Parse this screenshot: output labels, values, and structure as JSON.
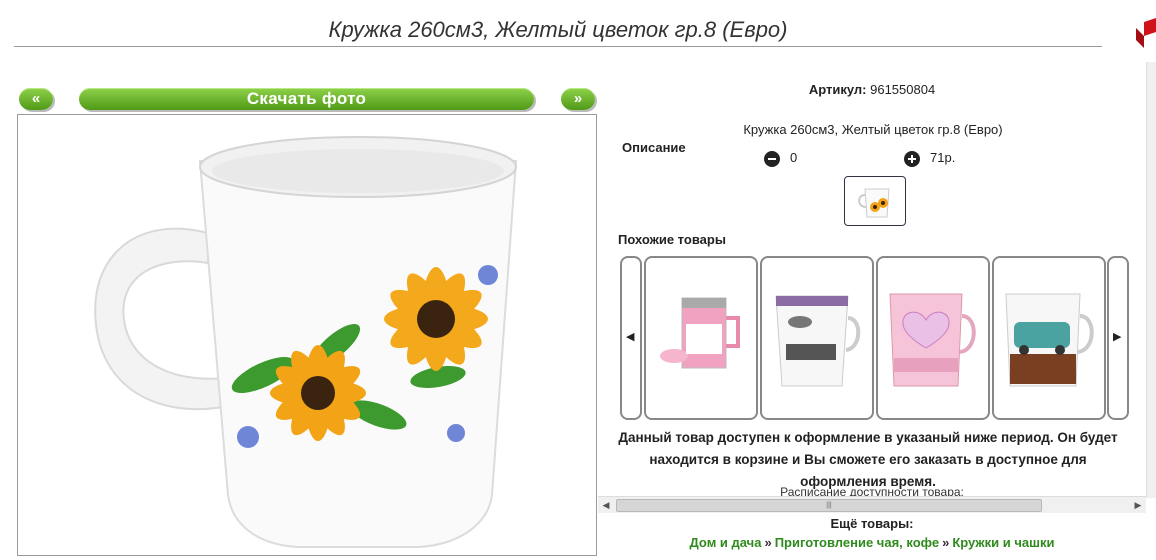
{
  "header": {
    "title": "Кружка 260см3, Желтый цветок гр.8 (Евро)"
  },
  "toolbar": {
    "prev_label": "«",
    "download_label": "Скачать фото",
    "next_label": "»"
  },
  "product": {
    "article_label": "Артикул:",
    "article_value": "961550804",
    "description_label": "Описание",
    "description_text": "Кружка 260см3, Желтый цветок гр.8 (Евро)",
    "qty_value": "0",
    "price_value": "71р."
  },
  "similar": {
    "label": "Похожие товары",
    "items": [
      "self-stirring-mug",
      "car-mug",
      "heart-mug",
      "retro-car-mug"
    ]
  },
  "notice": {
    "text": "Данный товар доступен к оформление в указаный ниже период. Он будет находится в корзине и Вы сможете его заказать в доступное для оформления время.",
    "schedule": "Расписание доступности товара:"
  },
  "more": {
    "label": "Ещё товары:",
    "crumbs": [
      "Дом и дача",
      "Приготовление чая, кофе",
      "Кружки и чашки"
    ],
    "separator": "»"
  },
  "colors": {
    "accent_green": "#5aa51f",
    "link_green": "#2f8a1e"
  }
}
